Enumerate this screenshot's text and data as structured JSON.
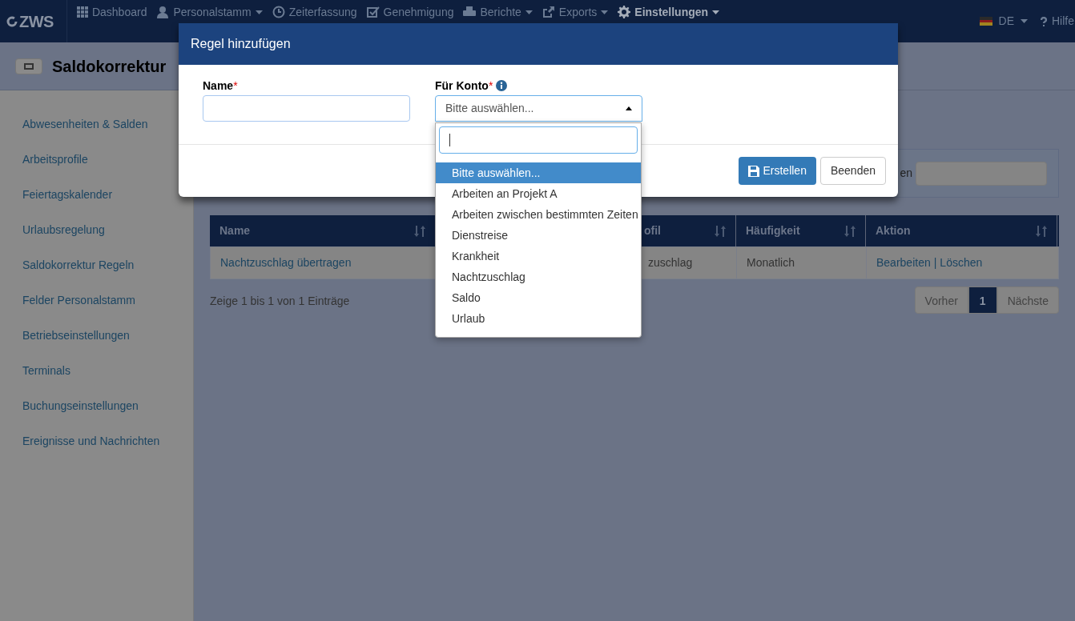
{
  "navbar": {
    "logo": "ZWS",
    "items": [
      {
        "label": "Dashboard",
        "kind": "grid",
        "dropdown": false,
        "active": false
      },
      {
        "label": "Personalstamm",
        "kind": "user",
        "dropdown": true,
        "active": false
      },
      {
        "label": "Zeiterfassung",
        "kind": "clock",
        "dropdown": false,
        "active": false
      },
      {
        "label": "Genehmigung",
        "kind": "check",
        "dropdown": false,
        "active": false
      },
      {
        "label": "Berichte",
        "kind": "printer",
        "dropdown": true,
        "active": false
      },
      {
        "label": "Exports",
        "kind": "export",
        "dropdown": true,
        "active": false
      },
      {
        "label": "Einstellungen",
        "kind": "gear",
        "dropdown": true,
        "active": true
      }
    ],
    "language": "DE",
    "help": "Hilfe"
  },
  "page_title": "Saldokorrektur",
  "sidebar": {
    "items": [
      "Abwesenheiten & Salden",
      "Arbeitsprofile",
      "Feiertagskalender",
      "Urlaubsregelung",
      "Saldokorrektur Regeln",
      "Felder Personalstamm",
      "Betriebseinstellungen",
      "Terminals",
      "Buchungseinstellungen",
      "Ereignisse und Nachrichten"
    ]
  },
  "filter": {
    "label": "en"
  },
  "table": {
    "columns": [
      "Name",
      "ofil",
      "Häufigkeit",
      "Aktion"
    ],
    "rows": [
      {
        "name": "Nachtzuschlag übertragen",
        "column_2": "zuschlag",
        "frequency": "Monatlich",
        "actions": [
          "Bearbeiten",
          "Löschen"
        ],
        "separator": "|"
      }
    ],
    "info": "Zeige 1 bis 1 von 1 Einträge",
    "pagination": [
      {
        "label": "Vorher",
        "selected": false
      },
      {
        "label": "1",
        "selected": true
      },
      {
        "label": "Nächste",
        "selected": false
      }
    ]
  },
  "modal": {
    "title": "Regel hinzufügen",
    "fields": [
      {
        "label": "Name",
        "required_mark": "*",
        "kind": "text"
      },
      {
        "label": "Für Konto",
        "required_mark": "*",
        "kind": "select",
        "info": true,
        "value": "Bitte auswählen...",
        "expanded": true
      }
    ],
    "dropdown": {
      "options": [
        {
          "label": "Bitte auswählen...",
          "selected": true
        },
        {
          "label": "Arbeiten an Projekt A",
          "selected": false
        },
        {
          "label": "Arbeiten zwischen bestimmten Zeiten",
          "selected": false
        },
        {
          "label": "Dienstreise",
          "selected": false
        },
        {
          "label": "Krankheit",
          "selected": false
        },
        {
          "label": "Nachtzuschlag",
          "selected": false
        },
        {
          "label": "Saldo",
          "selected": false
        },
        {
          "label": "Urlaub",
          "selected": false
        }
      ]
    },
    "buttons": [
      {
        "label": "Erstellen",
        "kind": "primary"
      },
      {
        "label": "Beenden",
        "kind": "default"
      }
    ]
  }
}
